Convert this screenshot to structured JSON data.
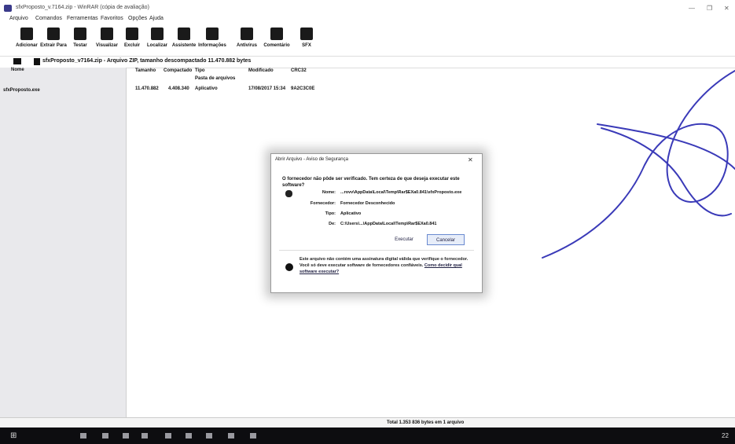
{
  "window": {
    "title": "sfxProposto_v.7164.zip - WinRAR (cópia de avaliação)",
    "minimize_glyph": "—",
    "maximize_glyph": "❐",
    "close_glyph": "✕",
    "icon": "winrar-icon"
  },
  "menu": [
    "Arquivo",
    "Comandos",
    "Ferramentas",
    "Favoritos",
    "Opções",
    "Ajuda"
  ],
  "toolbar": [
    {
      "label": "Adicionar",
      "icon": "add-archive-icon"
    },
    {
      "label": "Extrair Para",
      "icon": "extract-icon"
    },
    {
      "label": "Testar",
      "icon": "test-icon"
    },
    {
      "label": "Visualizar",
      "icon": "view-icon"
    },
    {
      "label": "Excluir",
      "icon": "delete-icon"
    },
    {
      "label": "Localizar",
      "icon": "find-icon"
    },
    {
      "label": "Assistente",
      "icon": "wizard-icon"
    },
    {
      "label": "Informações",
      "icon": "info-icon"
    },
    {
      "label": "Antivírus",
      "icon": "virus-scan-icon"
    },
    {
      "label": "Comentário",
      "icon": "comment-icon"
    },
    {
      "label": "SFX",
      "icon": "sfx-icon"
    }
  ],
  "addressbar": {
    "text": "sfxProposto_v7164.zip - Arquivo ZIP, tamanho descompactado 11.470.882 bytes"
  },
  "leftpane": {
    "header": "Nome",
    "items": [
      "sfxProposto.exe"
    ]
  },
  "filelist": {
    "columns": [
      "Nome",
      "Tamanho",
      "Compactado",
      "Tipo",
      "Modificado",
      "CRC32"
    ],
    "subheader": "Pasta de arquivos",
    "rows": [
      {
        "name": "",
        "size": "11.470.882",
        "packed": "4.408.340",
        "type": "Aplicativo",
        "modified": "17/08/2017 15:34",
        "crc": "9A2C3C0E"
      }
    ]
  },
  "status": {
    "left": "",
    "center": "Total 1.353 836 bytes em 1 arquivo"
  },
  "dialog": {
    "title": "Abrir Arquivo - Aviso de Segurança",
    "close_glyph": "✕",
    "question": "O fornecedor não pôde ser verificado. Tem certeza de que deseja executar este software?",
    "fields": [
      {
        "label": "Nome:",
        "value": "...rovv\\AppData\\Local\\Temp\\Rar$EXa0.841\\sfxProposto.exe"
      },
      {
        "label": "Fornecedor:",
        "value": "Fornecedor Desconhecido"
      },
      {
        "label": "Tipo:",
        "value": "Aplicativo"
      },
      {
        "label": "De:",
        "value": "C:\\Users\\...\\AppData\\Local\\Temp\\Rar$EXa0.841"
      }
    ],
    "execute_label": "Executar",
    "cancel_label": "Cancelar",
    "warning": "Este arquivo não contém uma assinatura digital válida que verifique o fornecedor. Você só deve executar software de fornecedores confiáveis.",
    "warning_link": "Como decidir qual software executar?"
  },
  "taskbar": {
    "start_glyph": "⊞",
    "clock": "22"
  },
  "colors": {
    "scribble": "#3a3ab8",
    "taskbar": "#0d0d10",
    "dialog_button_border": "#6a8ad0"
  }
}
